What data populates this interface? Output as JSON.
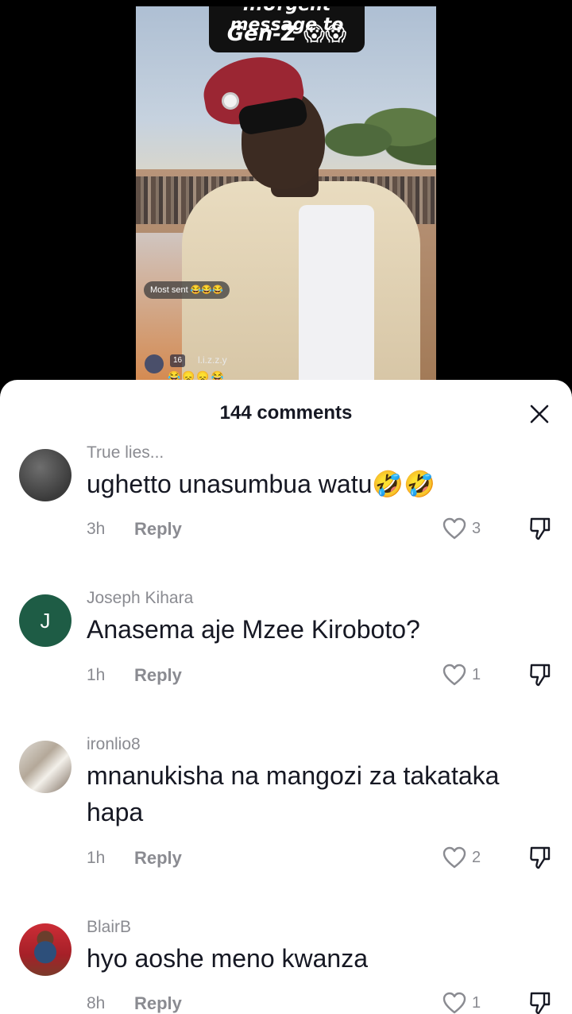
{
  "video": {
    "caption_top": "...Urgent message to",
    "caption_main": "Gen-Z 😱😱",
    "most_sent_label": "Most sent 😂😂😂",
    "live_badge": "16",
    "live_name": "l.i.z.z.y",
    "emoji_row": "😂😞😞😂"
  },
  "sheet": {
    "title": "144 comments",
    "close_icon": "close-icon"
  },
  "comments": [
    {
      "username": "True lies...",
      "text": "ughetto unasumbua watu🤣🤣",
      "time": "3h",
      "reply_label": "Reply",
      "likes": "3",
      "avatar_letter": ""
    },
    {
      "username": "Joseph Kihara",
      "text": "Anasema aje Mzee Kiroboto?",
      "time": "1h",
      "reply_label": "Reply",
      "likes": "1",
      "avatar_letter": "J"
    },
    {
      "username": "ironlio8",
      "text": "mnanukisha na mangozi za takataka hapa",
      "time": "1h",
      "reply_label": "Reply",
      "likes": "2",
      "avatar_letter": ""
    },
    {
      "username": "BlairB",
      "text": "hyo aoshe meno kwanza",
      "time": "8h",
      "reply_label": "Reply",
      "likes": "1",
      "avatar_letter": ""
    }
  ],
  "colors": {
    "text_primary": "#161823",
    "text_secondary": "#8a8b91",
    "avatar_j": "#1e5c45"
  }
}
